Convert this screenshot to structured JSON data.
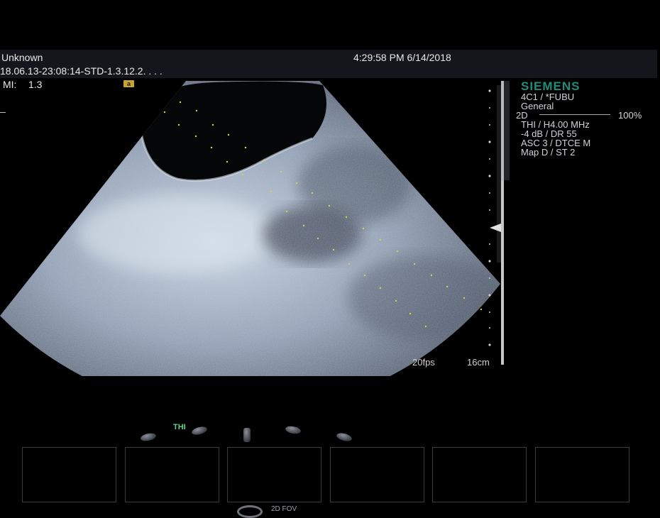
{
  "header": {
    "patient_name": "Unknown",
    "datetime": "4:29:58 PM 6/14/2018",
    "study_id": "18.06.13-23:08:14-STD-1.3.12.2. . . .",
    "mi_label": "MI:",
    "mi_value": "1.3",
    "badge": "a"
  },
  "side_panel": {
    "brand": "SIEMENS",
    "probe": "4C1 / *FUBU",
    "preset": "General",
    "mode": "2D",
    "mode_percent": "100%",
    "params": [
      "THI / H4.00 MHz",
      "-4 dB / DR 55",
      "ASC 3 / DTCE M",
      "Map D / ST 2"
    ]
  },
  "image_info": {
    "frame_rate": "20fps",
    "depth": "16cm"
  },
  "controls": {
    "thi_label": "THI",
    "fov_label": "2D FOV"
  },
  "colors": {
    "brand": "#1f8c7a",
    "calipers": "#d8d04a",
    "thi": "#5fd08e"
  }
}
